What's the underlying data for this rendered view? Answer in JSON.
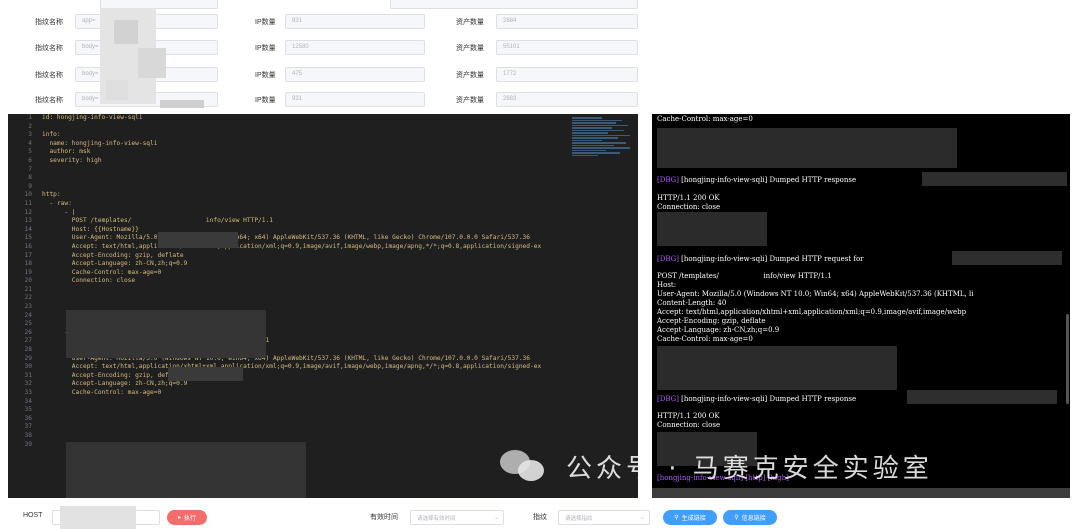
{
  "form": {
    "rows": [
      {
        "fp_label": "指纹名称",
        "fp_value": "app=",
        "ip_label": "IP数量",
        "ip_value": "931",
        "asset_label": "资产数量",
        "asset_value": "2884"
      },
      {
        "fp_label": "指纹名称",
        "fp_value": "body=",
        "ip_label": "IP数量",
        "ip_value": "12580",
        "asset_label": "资产数量",
        "asset_value": "55101"
      },
      {
        "fp_label": "指纹名称",
        "fp_value": "body=",
        "ip_label": "IP数量",
        "ip_value": "475",
        "asset_label": "资产数量",
        "asset_value": "1772"
      },
      {
        "fp_label": "指纹名称",
        "fp_value": "body=",
        "ip_label": "IP数量",
        "ip_value": "931",
        "asset_label": "资产数量",
        "asset_value": "2883"
      }
    ]
  },
  "editor": {
    "line_numbers": [
      "1",
      "2",
      "3",
      "4",
      "5",
      "6",
      "7",
      "8",
      "9",
      "10",
      "11",
      "12",
      "13",
      "14",
      "15",
      "16",
      "17",
      "18",
      "19",
      "20",
      "21",
      "22",
      "23",
      "24",
      "25",
      "26",
      "27",
      "28",
      "29",
      "30",
      "31",
      "32",
      "33",
      "34",
      "35",
      "36",
      "37",
      "38",
      "39"
    ],
    "lines": [
      "id: hongjing-info-view-sqli",
      "",
      "info:",
      "  name: hongjing-info-view-sqli",
      "  author: msk",
      "  severity: high",
      "",
      "",
      "",
      "http:",
      "  - raw:",
      "      - |",
      "        POST /templates/                    info/view HTTP/1.1",
      "        Host: {{Hostname}}",
      "        User-Agent: Mozilla/5.0 (Windows NT 10.0; Win64; x64) AppleWebKit/537.36 (KHTML, like Gecko) Chrome/107.0.0.0 Safari/537.36",
      "        Accept: text/html,application/xhtml+xml,application/xml;q=0.9,image/avif,image/webp,image/apng,*/*;q=0.8,application/signed-ex",
      "        Accept-Encoding: gzip, deflate",
      "        Accept-Language: zh-CN,zh;q=0.9",
      "        Cache-Control: max-age=0",
      "        Connection: close",
      "",
      "",
      "",
      "",
      "",
      "      - |",
      "        POST /templates/at                  nfo/view HTTP/1.1",
      "        Host: {{Hostname}}",
      "        User-Agent: Mozilla/5.0 (Windows NT 10.0; Win64; x64) AppleWebKit/537.36 (KHTML, like Gecko) Chrome/107.0.0.0 Safari/537.36",
      "        Accept: text/html,application/xhtml+xml,application/xml;q=0.9,image/avif,image/webp,image/apng,*/*;q=0.8,application/signed-ex",
      "        Accept-Encoding: gzip, deflate",
      "        Accept-Language: zh-CN,zh;q=0.9",
      "        Cache-Control: max-age=0",
      "",
      "",
      "",
      "",
      "",
      ""
    ]
  },
  "terminal": {
    "line1": "Cache-Control: max-age=0",
    "dbg_tag": "[DBG]",
    "dumped_response_1": " [hongjing-info-view-sqli] Dumped HTTP response",
    "http_ok_1": "HTTP/1.1 200 OK",
    "conn_close_1": "Connection: close",
    "dumped_request": " [hongjing-info-view-sqli] Dumped HTTP request for",
    "post_line": "POST /templates/                    info/view HTTP/1.1",
    "host_line": "Host:",
    "ua_line": "User-Agent: Mozilla/5.0 (Windows NT 10.0; Win64; x64) AppleWebKit/537.36 (KHTML, li",
    "cl_line": "Content-Length: 40",
    "accept_line": "Accept: text/html,application/xhtml+xml,application/xml;q=0.9,image/avif,image/webp",
    "ae_line": "Accept-Encoding: gzip, deflate",
    "al_line": "Accept-Language: zh-CN,zh;q=0.9",
    "cc_line": "Cache-Control: max-age=0",
    "dumped_response_2": " [hongjing-info-view-sqli] Dumped HTTP response",
    "http_ok_2": "HTTP/1.1 200 OK",
    "conn_close_2": "Connection: close",
    "last_line": "[hongjing-info-view-sqli] [http] [high]"
  },
  "watermark": {
    "text": "公众号 · 马赛克安全实验室"
  },
  "bottom": {
    "host_label": "HOST",
    "execute_label": "执行",
    "valid_time_label": "有效时间",
    "valid_time_placeholder": "请选择有效时间",
    "fingerprint_label": "指纹",
    "fingerprint_placeholder": "请选择指纹",
    "gen_link_label": "生成链接",
    "info_link_label": "信息链接"
  },
  "colors": {
    "execute": "#f56c6c",
    "primary": "#409eff",
    "dbg": "#b25cff"
  }
}
